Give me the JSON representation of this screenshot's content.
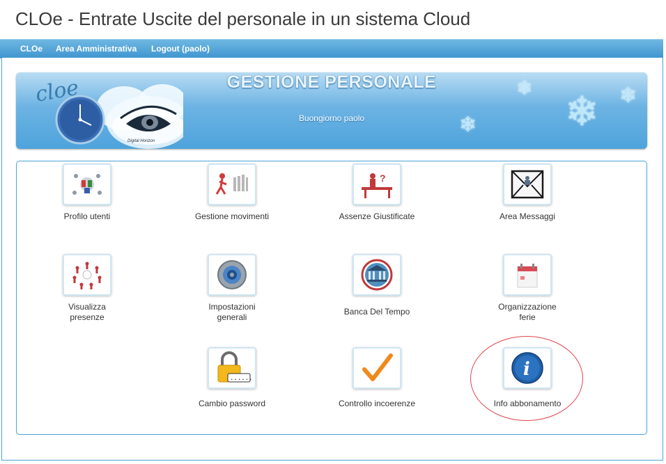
{
  "app": {
    "title": "CLOe - Entrate Uscite del personale in un sistema Cloud"
  },
  "nav": {
    "items": [
      "CLOe",
      "Area Amministrativa",
      "Logout (paolo)"
    ]
  },
  "banner": {
    "title": "GESTIONE PERSONALE",
    "greeting": "Buongiorno paolo",
    "logo_text": "cloe",
    "logo_subtext": "Digital Horizon"
  },
  "tiles": [
    {
      "label": "Profilo utenti",
      "icon": "people-network-icon"
    },
    {
      "label": "Gestione movimenti",
      "icon": "running-figures-icon"
    },
    {
      "label": "Assenze Giustificate",
      "icon": "desk-question-icon"
    },
    {
      "label": "Area Messaggi",
      "icon": "envelope-icon"
    },
    {
      "label": "Visualizza presenze",
      "icon": "team-circle-icon"
    },
    {
      "label": "Impostazioni generali",
      "icon": "gear-icon"
    },
    {
      "label": "Banca Del Tempo",
      "icon": "bank-icon"
    },
    {
      "label": "Organizzazione ferie",
      "icon": "calendar-icon"
    },
    {
      "label": "Cambio password",
      "icon": "padlock-icon"
    },
    {
      "label": "Controllo incoerenze",
      "icon": "checkmark-icon"
    },
    {
      "label": "Info abbonamento",
      "icon": "info-icon"
    }
  ],
  "colors": {
    "nav_bg": "#3f95cf",
    "banner_bg": "#4ea3dc",
    "highlight_ring": "#e0434b",
    "info_blue": "#1f5fa8",
    "check_orange": "#f08a1c"
  }
}
